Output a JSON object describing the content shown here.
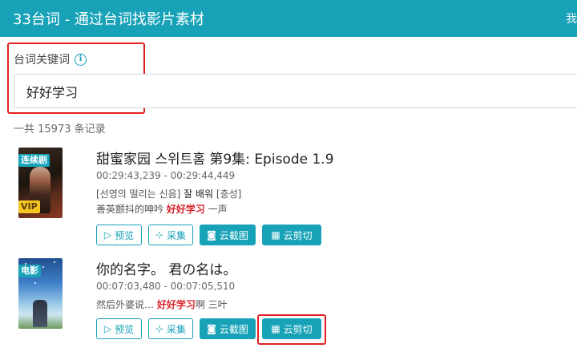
{
  "header": {
    "title": "33台词 - 通过台词找影片素材",
    "right_text": "我"
  },
  "search": {
    "label": "台词关键词",
    "value": "好好学习"
  },
  "result_count": "一共 15973 条记录",
  "buttons": {
    "preview": "预览",
    "collect": "采集",
    "screenshot": "云截图",
    "clip": "云剪切"
  },
  "results": [
    {
      "tag": "连续剧",
      "vip": "VIP",
      "title": "甜蜜家园 스위트홈 第9集: Episode 1.9",
      "time": "00:29:43,239 - 00:29:44,449",
      "original_pre": "[선영의 떨리는 신음] ",
      "original_hl": "잘 배워",
      "original_post": " [충성]",
      "sub_pre": "善英颤抖的呻吟 ",
      "sub_hl": "好好学习",
      "sub_post": " 一声"
    },
    {
      "tag": "电影",
      "title": "你的名字。 君の名は。",
      "time": "00:07:03,480 - 00:07:05,510",
      "sub_pre": "然后外婆说… ",
      "sub_hl": "好好学习",
      "sub_post": "啊 三叶"
    }
  ],
  "colors": {
    "accent": "#17a2b8",
    "highlight": "#d9262c",
    "annotation": "#e02020",
    "vip": "#f3c623"
  }
}
